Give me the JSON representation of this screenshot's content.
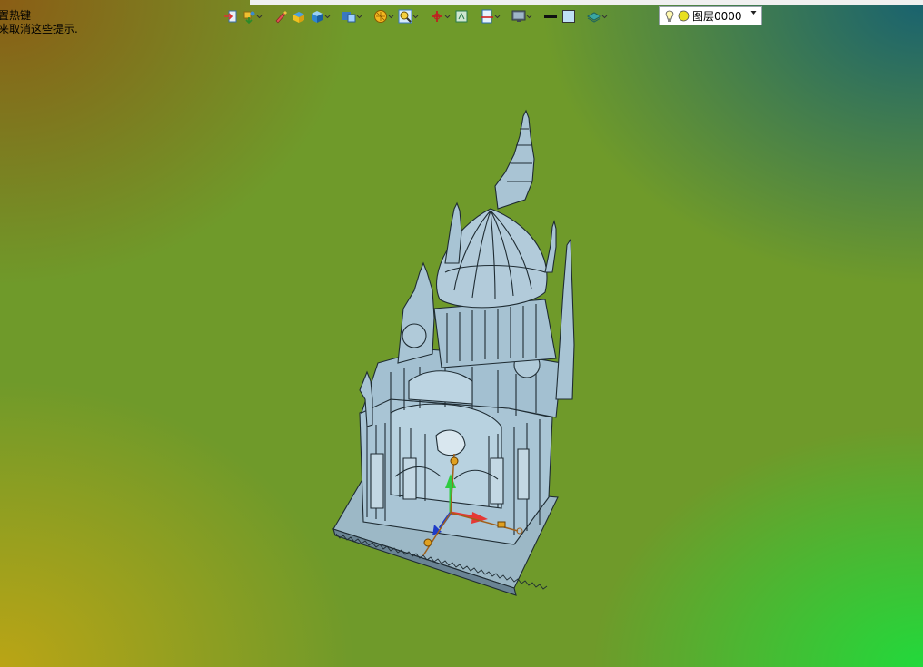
{
  "hint": {
    "line1": "置热键",
    "line2": "来取消这些提示."
  },
  "toolbar": {
    "items": [
      {
        "icon": "exit-sketch-icon",
        "dropdown": false
      },
      {
        "icon": "move-parts-icon",
        "dropdown": true
      },
      {
        "icon": "pen-icon",
        "dropdown": false
      },
      {
        "icon": "box-face-icon",
        "dropdown": false
      },
      {
        "icon": "cube-icon",
        "dropdown": true
      },
      {
        "icon": "part-view-icon",
        "dropdown": true
      },
      {
        "icon": "render-mode-icon",
        "dropdown": true
      },
      {
        "icon": "zoom-icon",
        "dropdown": true
      },
      {
        "icon": "axis-triad-icon",
        "dropdown": true
      },
      {
        "icon": "view-frame-icon",
        "dropdown": false
      },
      {
        "icon": "section-view-icon",
        "dropdown": true
      },
      {
        "icon": "display-monitor-icon",
        "dropdown": true
      },
      {
        "icon": "line-color-icon",
        "dropdown": false
      },
      {
        "icon": "fill-color-icon",
        "dropdown": false
      },
      {
        "icon": "layer-plane-icon",
        "dropdown": true
      }
    ]
  },
  "layer": {
    "name": "图层0000",
    "light_icon": "lightbulb-icon",
    "color_icon": "layer-color-icon"
  },
  "colors": {
    "model_fill": "#a8c4d4",
    "model_edge": "#1f2c33",
    "axis_x": "#e53935",
    "axis_y": "#2ecc40",
    "axis_z": "#1e3cc8",
    "handle": "#e0a020"
  }
}
